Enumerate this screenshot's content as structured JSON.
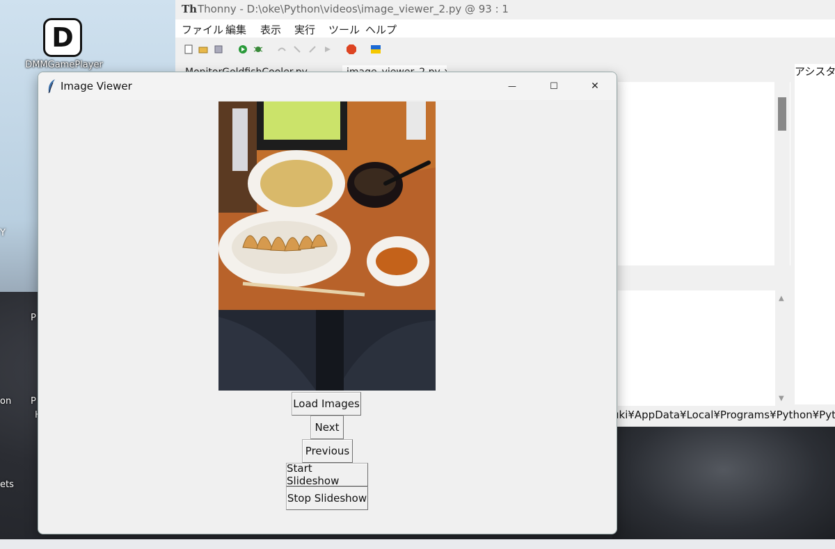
{
  "desktop": {
    "icon_label": "DMMGamePlayer",
    "icon_glyph": "D",
    "fragments": {
      "y": "Y",
      "p1": "P",
      "on": "on",
      "p2": "P",
      "h": "H",
      "ets": "ets"
    }
  },
  "thonny": {
    "title": "Thonny  -  D:\\oke\\Python\\videos\\image_viewer_2.py  @  93 : 1",
    "menu": [
      "ファイル",
      "編集",
      "表示",
      "実行",
      "ツール",
      "ヘルプ"
    ],
    "tabs": [
      "MonitorGoldfishCooler.py",
      "image_viewer_2.py ×"
    ],
    "assistant_label": "アシスタン",
    "path_text": "uki¥AppData¥Local¥Programs¥Python¥Python"
  },
  "image_viewer": {
    "title": "Image Viewer",
    "buttons": {
      "load": "Load Images",
      "next": "Next",
      "previous": "Previous",
      "start": "Start Slideshow",
      "stop": "Stop Slideshow"
    },
    "window_controls": {
      "minimize": "—",
      "maximize": "☐",
      "close": "✕"
    }
  }
}
